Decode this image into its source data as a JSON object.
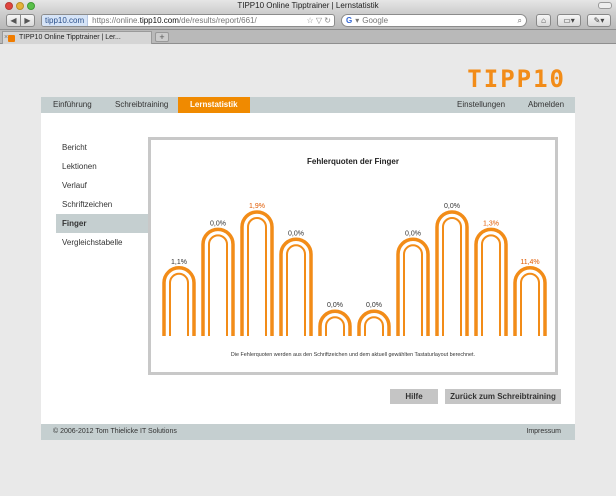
{
  "window": {
    "title": "TIPP10 Online Tipptrainer | Lernstatistik"
  },
  "browser": {
    "url_domain": "tipp10.com",
    "url_scheme": "https://online.",
    "url_host": "tipp10.com",
    "url_path": "/de/results/report/661/",
    "search_placeholder": "Google",
    "tab_title": "TIPP10 Online Tipptrainer | Ler..."
  },
  "logo": {
    "text": "TIPP10"
  },
  "nav": {
    "items": [
      "Einführung",
      "Schreibtraining",
      "Lernstatistik"
    ],
    "right": [
      "Einstellungen",
      "Abmelden"
    ],
    "active": "Lernstatistik"
  },
  "sidebar": {
    "items": [
      "Bericht",
      "Lektionen",
      "Verlauf",
      "Schriftzeichen",
      "Finger",
      "Vergleichstabelle"
    ],
    "active": "Finger"
  },
  "chart_data": {
    "type": "bar",
    "title": "Fehlerquoten der Finger",
    "categories": [
      "",
      "",
      "",
      "",
      "",
      "",
      "",
      "",
      "",
      ""
    ],
    "values": [
      1.1,
      0.0,
      1.9,
      0.0,
      0.0,
      0.0,
      0.0,
      0.0,
      1.3,
      11.4
    ],
    "labels": [
      "1,1%",
      "0,0%",
      "1,9%",
      "0,0%",
      "0,0%",
      "0,0%",
      "0,0%",
      "0,0%",
      "1,3%",
      "11,4%"
    ],
    "label_colors": [
      "#333333",
      "#333333",
      "#e05a00",
      "#333333",
      "#333333",
      "#333333",
      "#333333",
      "#333333",
      "#e05a00",
      "#e05a00"
    ],
    "finger_heights": [
      0.55,
      0.86,
      1.0,
      0.78,
      0.2,
      0.2,
      0.78,
      1.0,
      0.86,
      0.55
    ],
    "note": "Die Fehlerquoten werden aus den Schriftzeichen und dem aktuell gewählten Tastaturlayout berechnet.",
    "accent": "#f28c18"
  },
  "buttons": {
    "help": "Hilfe",
    "back": "Zurück zum Schreibtraining"
  },
  "footer": {
    "copyright": "© 2006-2012 Tom Thielicke IT Solutions",
    "imprint": "Impressum"
  }
}
